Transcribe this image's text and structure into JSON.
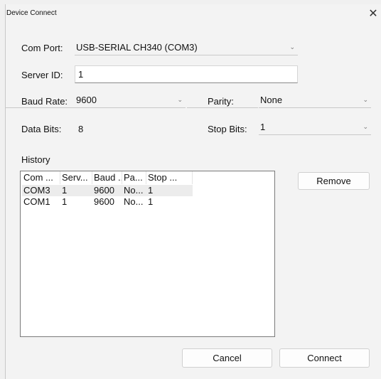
{
  "window": {
    "title": "Device Connect",
    "close_glyph": "✕"
  },
  "form": {
    "com_port_label": "Com Port:",
    "com_port_value": "USB-SERIAL CH340 (COM3)",
    "server_id_label": "Server ID:",
    "server_id_value": "1",
    "baud_rate_label": "Baud Rate:",
    "baud_rate_value": "9600",
    "parity_label": "Parity:",
    "parity_value": "None",
    "data_bits_label": "Data Bits:",
    "data_bits_value": "8",
    "stop_bits_label": "Stop Bits:",
    "stop_bits_value": "1",
    "chevron": "⌄"
  },
  "history": {
    "label": "History",
    "columns": [
      "Com ...",
      "Serv...",
      "Baud ...",
      "Pa...",
      "Stop ..."
    ],
    "rows": [
      [
        "COM3",
        "1",
        "9600",
        "No...",
        "1"
      ],
      [
        "COM1",
        "1",
        "9600",
        "No...",
        "1"
      ]
    ],
    "selected_row": 0
  },
  "buttons": {
    "remove": "Remove",
    "cancel": "Cancel",
    "connect": "Connect"
  }
}
